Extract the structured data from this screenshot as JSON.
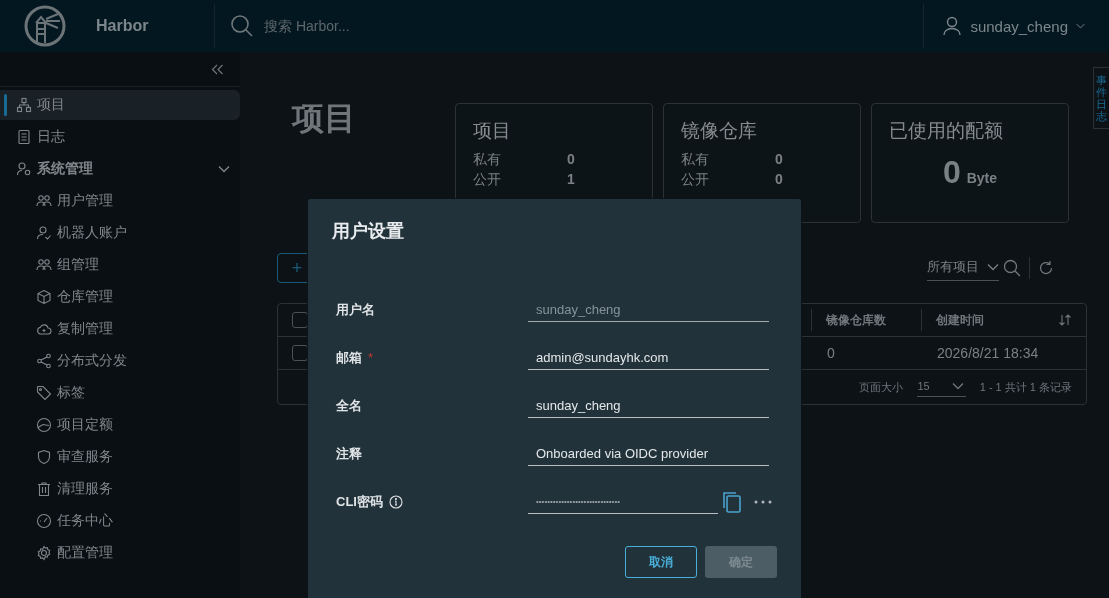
{
  "header": {
    "product": "Harbor",
    "search_placeholder": "搜索 Harbor...",
    "user": "sunday_cheng"
  },
  "sidebar": {
    "items": [
      {
        "label": "项目",
        "selected": true
      },
      {
        "label": "日志",
        "selected": false
      },
      {
        "label": "系统管理",
        "selected": false,
        "expanded": true,
        "children": [
          {
            "label": "用户管理",
            "selected": false
          },
          {
            "label": "机器人账户",
            "selected": false
          },
          {
            "label": "组管理",
            "selected": false
          },
          {
            "label": "仓库管理",
            "selected": false
          },
          {
            "label": "复制管理",
            "selected": false
          },
          {
            "label": "分布式分发",
            "selected": false
          },
          {
            "label": "标签",
            "selected": false
          },
          {
            "label": "项目定额",
            "selected": false
          },
          {
            "label": "审查服务",
            "selected": false
          },
          {
            "label": "清理服务",
            "selected": false
          },
          {
            "label": "任务中心",
            "selected": false
          },
          {
            "label": "配置管理",
            "selected": false
          }
        ]
      }
    ]
  },
  "page_title": "项目",
  "stat_cards": [
    {
      "kind": "counts",
      "title": "项目",
      "rows": [
        {
          "label": "私有",
          "value": "0"
        },
        {
          "label": "公开",
          "value": "1"
        }
      ]
    },
    {
      "kind": "counts",
      "title": "镜像仓库",
      "rows": [
        {
          "label": "私有",
          "value": "0"
        },
        {
          "label": "公开",
          "value": "0"
        }
      ]
    },
    {
      "kind": "quota",
      "title": "已使用的配额",
      "value": "0",
      "unit": "Byte"
    }
  ],
  "toolbar": {
    "add_button": "+",
    "filter": "所有项目"
  },
  "table": {
    "header_checked": false,
    "columns": [
      {
        "label": "镜像仓库数"
      },
      {
        "label": "创建时间"
      }
    ],
    "rows": [
      {
        "checked": false,
        "cells": [
          "0",
          "2026/8/21 18:34"
        ]
      }
    ],
    "footer": {
      "page_size_label": "页面大小",
      "page_size": "15",
      "summary": "1 - 1 共计 1 条记录"
    }
  },
  "event_log_tab": "事件日志",
  "dialog": {
    "title": "用户设置",
    "fields": [
      {
        "kind": "text",
        "label": "用户名",
        "value": "sunday_cheng",
        "disabled": true,
        "required": false
      },
      {
        "kind": "text",
        "label": "邮箱",
        "value": "admin@sundayhk.com",
        "disabled": false,
        "required": true,
        "required_mark": "*"
      },
      {
        "kind": "text",
        "label": "全名",
        "value": "sunday_cheng",
        "disabled": false,
        "required": false
      },
      {
        "kind": "text",
        "label": "注释",
        "value": "Onboarded via OIDC provider",
        "disabled": false,
        "required": false
      },
      {
        "kind": "secret",
        "label": "CLI密码",
        "value": "••••••••••••••••••••••••••••••",
        "disabled": false,
        "required": false
      }
    ],
    "buttons": [
      {
        "kind": "outline",
        "label": "取消",
        "disabled": false
      },
      {
        "kind": "primary",
        "label": "确定",
        "disabled": true
      }
    ]
  }
}
